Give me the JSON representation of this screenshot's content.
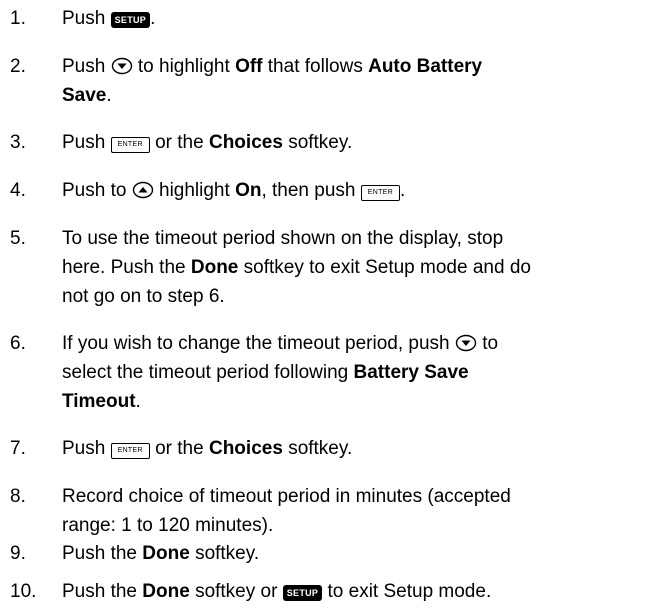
{
  "keys": {
    "setup": "SETUP",
    "enter": "ENTER"
  },
  "icons": {
    "down": "down-arrow-key-icon",
    "up": "up-arrow-key-icon"
  },
  "steps": [
    {
      "number": "1.",
      "t": [
        "Push",
        "."
      ]
    },
    {
      "number": "2.",
      "t": [
        "Push",
        "to highlight",
        "Off",
        "that follows",
        "Auto Battery",
        "Save",
        "."
      ]
    },
    {
      "number": "3.",
      "t": [
        "Push",
        "or the",
        "Choices",
        "softkey."
      ]
    },
    {
      "number": "4.",
      "t": [
        "Push to",
        "highlight",
        "On",
        ", then push",
        "."
      ]
    },
    {
      "number": "5.",
      "t": [
        "To use the timeout period shown on the display, stop",
        "here. Push the",
        "Done",
        "softkey to exit Setup mode and do",
        "not go on to step 6."
      ]
    },
    {
      "number": "6.",
      "t": [
        "If you wish to change the timeout period, push",
        "to",
        "select the timeout period following",
        "Battery Save",
        "Timeout",
        "."
      ]
    },
    {
      "number": "7.",
      "t": [
        "Push",
        "or the",
        "Choices",
        "softkey."
      ]
    },
    {
      "number": "8.",
      "t": [
        "Record choice of timeout period in minutes (accepted",
        "range: 1 to 120 minutes)."
      ]
    },
    {
      "number": "9.",
      "t": [
        "Push the",
        "Done",
        "softkey."
      ]
    },
    {
      "number": "10.",
      "t": [
        "Push the",
        "Done",
        "softkey or",
        "to exit Setup mode."
      ]
    }
  ]
}
